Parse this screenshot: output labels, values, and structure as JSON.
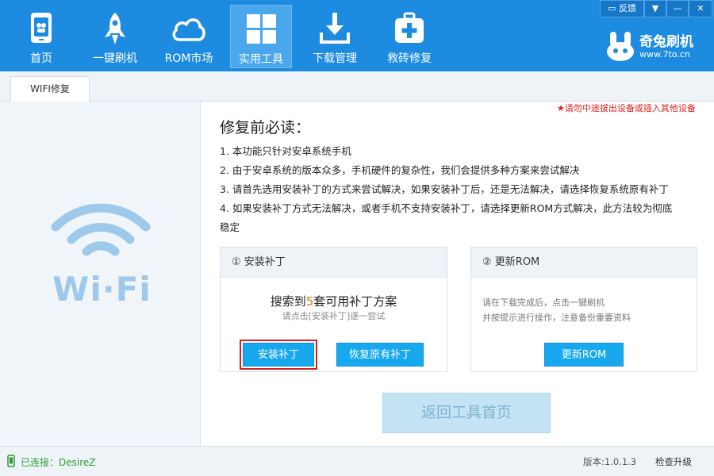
{
  "nav": {
    "items": [
      {
        "label": "首页",
        "icon": "home-phone-icon"
      },
      {
        "label": "一键刷机",
        "icon": "rocket-icon"
      },
      {
        "label": "ROM市场",
        "icon": "cloud-icon"
      },
      {
        "label": "实用工具",
        "icon": "grid-tools-icon",
        "active": true
      },
      {
        "label": "下载管理",
        "icon": "download-icon"
      },
      {
        "label": "救砖修复",
        "icon": "first-aid-kit-icon"
      }
    ]
  },
  "window": {
    "feedback_label": "反馈",
    "menu_glyph": "▼",
    "minimize_glyph": "—",
    "close_glyph": "✕"
  },
  "brand": {
    "name": "奇兔刷机",
    "url": "www.7to.cn"
  },
  "tabs": [
    {
      "label": "WIFI修复"
    }
  ],
  "content": {
    "warning": "★请勿中途拔出设备或插入其他设备",
    "heading": "修复前必读：",
    "lines": [
      "1. 本功能只针对安卓系统手机",
      "2. 由于安卓系统的版本众多，手机硬件的复杂性，我们会提供多种方案来尝试解决",
      "3. 请首先选用安装补丁的方式来尝试解决，如果安装补丁后，还是无法解决，请选择恢复系统原有补丁",
      "4. 如果安装补丁方式无法解决，或者手机不支持安装补丁，请选择更新ROM方式解决，此方法较为彻底",
      "稳定"
    ]
  },
  "card_patch": {
    "title": "① 安装补丁",
    "found_prefix": "搜索到",
    "found_count": "5",
    "found_suffix": "套可用补丁方案",
    "hint": "请点击[安装补丁]逐一尝试",
    "install_button": "安装补丁",
    "restore_button": "恢复原有补丁"
  },
  "card_rom": {
    "title": "② 更新ROM",
    "line1": "请在下载完成后，点击一键刷机",
    "line2": "并按提示进行操作，注意备份重要资料",
    "update_button": "更新ROM"
  },
  "back_button": "返回工具首页",
  "status": {
    "connected": "已连接：DesireZ",
    "version": "版本:1.0.1.3",
    "check_update": "检查升级"
  },
  "wifi_logo_text": "Wi·Fi",
  "colors": {
    "topbar": "#1d8be0",
    "button": "#17a8ef",
    "highlight_box": "#d61f1f",
    "count_orange": "#f07a0c",
    "connected_green": "#2f9a2f",
    "warning_red": "#e02020"
  }
}
